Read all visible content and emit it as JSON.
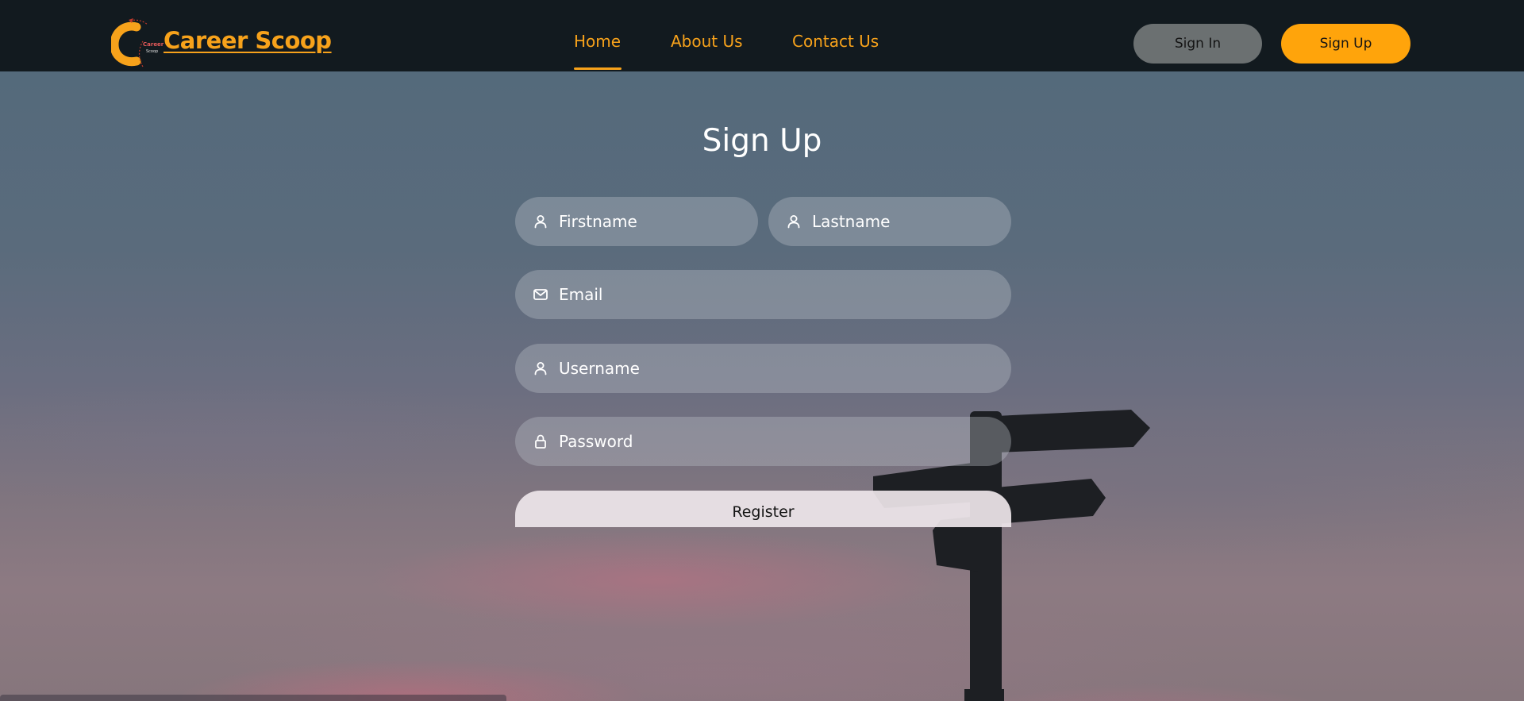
{
  "navbar": {
    "brand": "Career Scoop",
    "logo_text": "Career",
    "logo_subtext": "Scoop",
    "links": [
      {
        "label": "Home",
        "active": true
      },
      {
        "label": "About Us",
        "active": false
      },
      {
        "label": "Contact Us",
        "active": false
      }
    ],
    "sign_in_label": "Sign In",
    "sign_up_label": "Sign Up"
  },
  "form": {
    "title": "Sign Up",
    "fields": {
      "firstname": {
        "placeholder": "Firstname",
        "icon": "user-icon",
        "value": ""
      },
      "lastname": {
        "placeholder": "Lastname",
        "icon": "user-icon",
        "value": ""
      },
      "email": {
        "placeholder": "Email",
        "icon": "mail-icon",
        "value": ""
      },
      "username": {
        "placeholder": "Username",
        "icon": "user-icon",
        "value": ""
      },
      "password": {
        "placeholder": "Password",
        "icon": "lock-icon",
        "value": ""
      }
    },
    "submit_label": "Register"
  },
  "colors": {
    "accent": "#ffa40b",
    "brand_text": "#f7a21b",
    "navbar_bg": "#121a1f",
    "sign_in_bg": "#6b7071"
  }
}
